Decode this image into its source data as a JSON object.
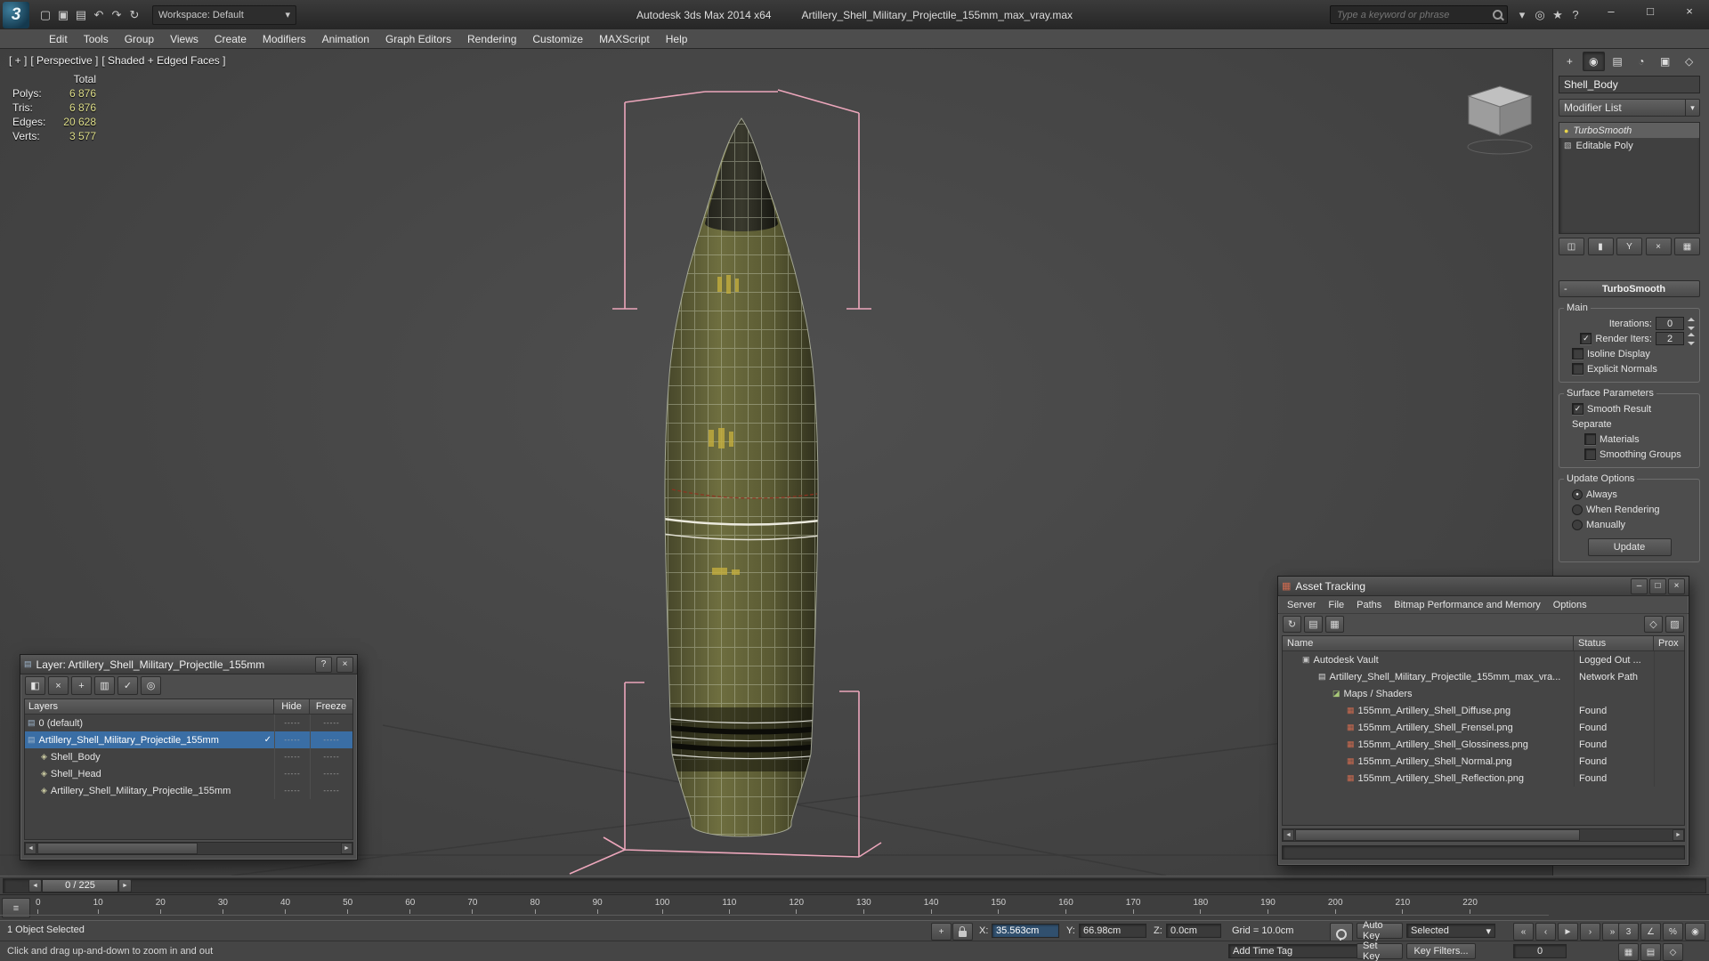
{
  "titlebar": {
    "logo_glyph": "3",
    "quick_icons": [
      {
        "n": "new-scene-icon",
        "g": "▢"
      },
      {
        "n": "open-file-icon",
        "g": "▣"
      },
      {
        "n": "save-file-icon",
        "g": "▤"
      },
      {
        "n": "undo-icon",
        "g": "↶"
      },
      {
        "n": "redo-icon",
        "g": "↷"
      },
      {
        "n": "fetch-icon",
        "g": "↻"
      }
    ],
    "workspace": "Workspace: Default",
    "workspace_arrow": "▾",
    "app_title": "Autodesk 3ds Max 2014 x64",
    "doc_title": "Artillery_Shell_Military_Projectile_155mm_max_vray.max",
    "search": {
      "placeholder": "Type a keyword or phrase"
    },
    "info_icons": [
      {
        "n": "search-settings-icon",
        "g": "▾"
      },
      {
        "n": "communication-center-icon",
        "g": "◎"
      },
      {
        "n": "favorites-icon",
        "g": "★"
      },
      {
        "n": "help-icon",
        "g": "?"
      }
    ],
    "window_buttons": [
      {
        "n": "minimize-button",
        "g": "–"
      },
      {
        "n": "maximize-button",
        "g": "□"
      },
      {
        "n": "close-button",
        "g": "×"
      }
    ]
  },
  "menubar": {
    "items": [
      "Edit",
      "Tools",
      "Group",
      "Views",
      "Create",
      "Modifiers",
      "Animation",
      "Graph Editors",
      "Rendering",
      "Customize",
      "MAXScript",
      "Help"
    ]
  },
  "viewport": {
    "label_plus": "[ + ]",
    "label_view": "[ Perspective ]",
    "label_shading": "[ Shaded + Edged Faces ]",
    "stats": {
      "total_label": "Total",
      "rows": [
        {
          "label": "Polys:",
          "value": "6 876"
        },
        {
          "label": "Tris:",
          "value": "6 876"
        },
        {
          "label": "Edges:",
          "value": "20 628"
        },
        {
          "label": "Verts:",
          "value": "3 577"
        }
      ]
    }
  },
  "command_panel": {
    "tabs": [
      {
        "n": "create-tab",
        "g": "+"
      },
      {
        "n": "modify-tab",
        "g": "◉",
        "active": true
      },
      {
        "n": "hierarchy-tab",
        "g": "▤"
      },
      {
        "n": "motion-tab",
        "g": "◔"
      },
      {
        "n": "display-tab",
        "g": "▣"
      },
      {
        "n": "utilities-tab",
        "g": "◇"
      }
    ],
    "object_name": "Shell_Body",
    "modifier_list_label": "Modifier List",
    "modifier_list_arrow": "▾",
    "stack": [
      {
        "icon": "bulb-icon",
        "icon_glyph": "●",
        "label": "TurboSmooth",
        "selected": true
      },
      {
        "icon": "poly-icon",
        "icon_glyph": "▧",
        "label": "Editable Poly"
      }
    ],
    "stack_buttons": [
      {
        "n": "pin-stack-button",
        "g": "◫"
      },
      {
        "n": "show-end-result-button",
        "g": "▮"
      },
      {
        "n": "make-unique-button",
        "g": "Y"
      },
      {
        "n": "remove-modifier-button",
        "g": "×"
      },
      {
        "n": "configure-modifier-sets-button",
        "g": "▦"
      }
    ],
    "rollout": {
      "collapse_glyph": "-",
      "title": "TurboSmooth",
      "main": {
        "title": "Main",
        "iterations_label": "Iterations:",
        "iterations_value": "0",
        "render_iters_label": "Render Iters:",
        "render_iters_value": "2",
        "render_iters_check": "✓",
        "isoline_label": "Isoline Display",
        "isoline_check": "",
        "explicit_label": "Explicit Normals",
        "explicit_check": ""
      },
      "surface": {
        "title": "Surface Parameters",
        "smooth_result_label": "Smooth Result",
        "smooth_result_check": "✓",
        "separate_label": "Separate",
        "materials_label": "Materials",
        "materials_check": "",
        "smoothing_groups_label": "Smoothing Groups",
        "smoothing_groups_check": ""
      },
      "update": {
        "title": "Update Options",
        "options": [
          {
            "label": "Always",
            "dot": "●"
          },
          {
            "label": "When Rendering",
            "dot": ""
          },
          {
            "label": "Manually",
            "dot": ""
          }
        ],
        "button": "Update"
      }
    }
  },
  "layer_dialog": {
    "title": "Layer: Artillery_Shell_Military_Projectile_155mm",
    "title_icon_glyph": "▤",
    "help_glyph": "?",
    "close_glyph": "×",
    "toolbar": [
      {
        "n": "create-layer-icon",
        "g": "◧"
      },
      {
        "n": "delete-layer-icon",
        "g": "×"
      },
      {
        "n": "add-to-layer-icon",
        "g": "+"
      },
      {
        "n": "select-layer-objects-icon",
        "g": "▥"
      },
      {
        "n": "set-current-layer-icon",
        "g": "✓"
      },
      {
        "n": "highlight-layer-icon",
        "g": "◎"
      }
    ],
    "columns": {
      "layers": "Layers",
      "hide": "Hide",
      "freeze": "Freeze"
    },
    "rows": [
      {
        "icon": "layer-icon",
        "icon_glyph": "▤",
        "label": "0 (default)",
        "check": "",
        "hide": "-----",
        "freeze": "-----"
      },
      {
        "icon": "layer-icon",
        "icon_glyph": "▤",
        "label": "Artillery_Shell_Military_Projectile_155mm",
        "selected": true,
        "check": "✓",
        "hide": "-----",
        "freeze": "-----"
      },
      {
        "icon": "object-icon",
        "icon_glyph": "◈",
        "label": "Shell_Body",
        "indent": 1,
        "check": "",
        "hide": "-----",
        "freeze": "-----"
      },
      {
        "icon": "object-icon",
        "icon_glyph": "◈",
        "label": "Shell_Head",
        "indent": 1,
        "check": "",
        "hide": "-----",
        "freeze": "-----"
      },
      {
        "icon": "object-icon",
        "icon_glyph": "◈",
        "label": "Artillery_Shell_Military_Projectile_155mm",
        "indent": 1,
        "check": "",
        "hide": "-----",
        "freeze": "-----"
      }
    ]
  },
  "asset_dialog": {
    "title": "Asset Tracking",
    "title_icon_glyph": "▦",
    "window_buttons": [
      {
        "n": "minimize-button",
        "g": "–"
      },
      {
        "n": "maximize-button",
        "g": "□"
      },
      {
        "n": "close-button",
        "g": "×"
      }
    ],
    "menu": [
      "Server",
      "File",
      "Paths",
      "Bitmap Performance and Memory",
      "Options"
    ],
    "toolbar_left": [
      {
        "n": "refresh-icon",
        "g": "↻"
      },
      {
        "n": "table-view-icon",
        "g": "▤"
      },
      {
        "n": "details-view-icon",
        "g": "▦"
      }
    ],
    "toolbar_right": [
      {
        "n": "vault-settings-icon",
        "g": "◇"
      },
      {
        "n": "filter-icon",
        "g": "▨"
      }
    ],
    "columns": {
      "name": "Name",
      "status": "Status",
      "proxy": "Prox"
    },
    "rows": [
      {
        "icon": "vault-icon",
        "icon_glyph": "▣",
        "name": "Autodesk Vault",
        "status": "Logged Out ...",
        "indent": 1
      },
      {
        "icon": "scene-file-icon",
        "icon_glyph": "▤",
        "name": "Artillery_Shell_Military_Projectile_155mm_max_vra...",
        "status": "Network Path",
        "indent": 2
      },
      {
        "icon": "maps-icon",
        "icon_glyph": "◪",
        "name": "Maps / Shaders",
        "status": "",
        "indent": 3
      },
      {
        "icon": "bitmap-icon",
        "icon_glyph": "▦",
        "name": "155mm_Artillery_Shell_Diffuse.png",
        "status": "Found",
        "indent": 4
      },
      {
        "icon": "bitmap-icon",
        "icon_glyph": "▦",
        "name": "155mm_Artillery_Shell_Frensel.png",
        "status": "Found",
        "indent": 4
      },
      {
        "icon": "bitmap-icon",
        "icon_glyph": "▦",
        "name": "155mm_Artillery_Shell_Glossiness.png",
        "status": "Found",
        "indent": 4
      },
      {
        "icon": "bitmap-icon",
        "icon_glyph": "▦",
        "name": "155mm_Artillery_Shell_Normal.png",
        "status": "Found",
        "indent": 4
      },
      {
        "icon": "bitmap-icon",
        "icon_glyph": "▦",
        "name": "155mm_Artillery_Shell_Reflection.png",
        "status": "Found",
        "indent": 4
      }
    ]
  },
  "timeline": {
    "slider_label": "0 / 225",
    "left_arrow": "◄",
    "right_arrow": "►",
    "mini_curve_glyph": "≡",
    "ticks": [
      "0",
      "10",
      "20",
      "30",
      "40",
      "50",
      "60",
      "70",
      "80",
      "90",
      "100",
      "110",
      "120",
      "130",
      "140",
      "150",
      "160",
      "170",
      "180",
      "190",
      "200",
      "210",
      "220"
    ]
  },
  "statusbar": {
    "selection": "1 Object Selected",
    "abs_mode_glyph": "+",
    "x_label": "X:",
    "x_value": "35.563cm",
    "y_label": "Y:",
    "y_value": "66.98cm",
    "z_label": "Z:",
    "z_value": "0.0cm",
    "grid_label": "Grid = 10.0cm",
    "auto_key": "Auto Key",
    "set_key": "Set Key",
    "selected_mode": "Selected",
    "selected_arrow": "▾",
    "key_filters": "Key Filters...",
    "add_time_tag": "Add Time Tag",
    "prompt": "Click and drag up-and-down to zoom in and out",
    "frame_field": "0",
    "playback": [
      {
        "n": "go-start-button",
        "g": "«"
      },
      {
        "n": "prev-frame-button",
        "g": "‹"
      },
      {
        "n": "play-button",
        "g": "►"
      },
      {
        "n": "next-frame-button",
        "g": "›"
      },
      {
        "n": "go-end-button",
        "g": "»"
      }
    ],
    "snap_icons": [
      {
        "n": "snap-toggle-icon",
        "g": "3"
      },
      {
        "n": "angle-snap-icon",
        "g": "∠"
      },
      {
        "n": "percent-snap-icon",
        "g": "%"
      },
      {
        "n": "spinner-snap-icon",
        "g": "◉"
      }
    ],
    "misc_icons": [
      {
        "n": "isolate-selection-icon",
        "g": "▦"
      },
      {
        "n": "display-filter-icon",
        "g": "▤"
      },
      {
        "n": "maxscript-listener-icon",
        "g": "◇"
      }
    ]
  }
}
